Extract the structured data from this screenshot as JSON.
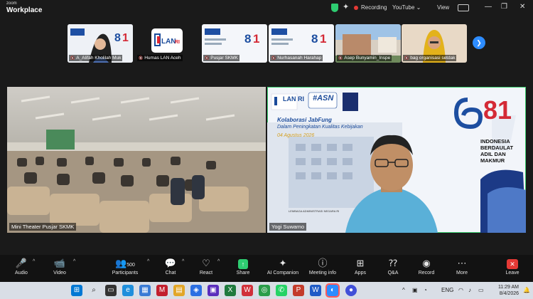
{
  "app": {
    "logo_top": "zoom",
    "logo_bottom": "Workplace"
  },
  "titlebar": {
    "recording": "Recording",
    "youtube": "YouTube",
    "view": "View"
  },
  "participants": [
    {
      "name": "A_Alifah Kholilah Muk"
    },
    {
      "name": "Humas LAN Aceh",
      "logo": "LAN RI"
    },
    {
      "name": "Pusjar SKMK"
    },
    {
      "name": "Nurhasanah Harahap"
    },
    {
      "name": "Asep Bunyamin_Inspe"
    },
    {
      "name": "bag organisasi setdak"
    }
  ],
  "main_videos": {
    "left": {
      "name": "Mini Theater Pusjar SKMK"
    },
    "right": {
      "name": "Yogi Suwarno"
    }
  },
  "slide": {
    "logo": "LAN RI",
    "asn": "#ASN",
    "title": "Kolaborasi JabFung",
    "subtitle": "Dalam Peningkatan Kualitas Kebijakan",
    "date": "04 Agustus 2026",
    "number": "81",
    "motto": [
      "INDONESIA",
      "BERDAULAT",
      "ADIL DAN",
      "MAKMUR"
    ],
    "building": "LEMBAGA ADMINISTRASI NEGARA RI"
  },
  "toolbar": {
    "audio": "Audio",
    "video": "Video",
    "participants": "Participants",
    "participants_count": "500",
    "chat": "Chat",
    "react": "React",
    "share": "Share",
    "ai": "AI Companion",
    "meeting_info": "Meeting info",
    "apps": "Apps",
    "qa": "Q&A",
    "record": "Record",
    "more": "More",
    "leave": "Leave"
  },
  "taskbar": {
    "lang": "ENG",
    "time": "11:29 AM",
    "date": "8/4/2026"
  },
  "colors": {
    "accent": "#2d8cff",
    "share": "#2ecc71",
    "leave": "#e53935"
  }
}
